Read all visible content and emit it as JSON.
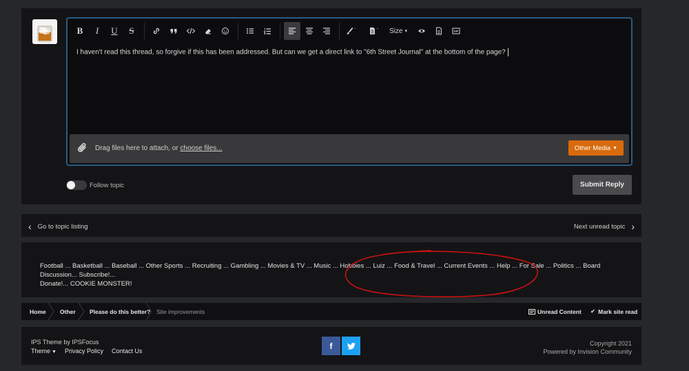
{
  "editor": {
    "toolbar": {
      "bold": "B",
      "italic": "I",
      "underline": "U",
      "strike": "S",
      "size_label": "Size"
    },
    "content": "I haven't read this thread, so forgive if this has been addressed.  But can we get a direct link to \"6th Street Journal\" at the bottom of the page?",
    "attach_prefix": "Drag files here to attach, or ",
    "attach_link": "choose files...",
    "other_media_label": "Other Media"
  },
  "reply": {
    "follow_label": "Follow topic",
    "follow_on": false,
    "submit_label": "Submit Reply"
  },
  "topic_nav": {
    "prev_label": "Go to topic listing",
    "next_label": "Next unread topic"
  },
  "forum_links": {
    "line1": "Football ... Basketball ... Baseball ... Other Sports ... Recruiting ... Gambling ... Movies & TV ... Music ... Hobbies ... Luiz ... Food & Travel ... Current Events ... Help ... For Sale ... Politics ... Board Discussion... Subscribe!...",
    "line2": "Donate!... COOKIE MONSTER!"
  },
  "breadcrumb": {
    "items": [
      "Home",
      "Other",
      "Please do this better?"
    ],
    "current": "Site improvements",
    "unread_label": "Unread Content",
    "mark_read_label": "Mark site read"
  },
  "footer": {
    "theme_line": "IPS Theme by IPSFocus",
    "links": [
      "Theme",
      "Privacy Policy",
      "Contact Us"
    ],
    "social": [
      "f",
      "t"
    ],
    "copyright": "Copyright 2021",
    "powered": "Powered by Invision Community"
  },
  "colors": {
    "accent": "#d86b0c",
    "editor_border": "#2b5c85",
    "annotation": "#cc1111",
    "facebook": "#3b5998",
    "twitter": "#1da1f2"
  }
}
